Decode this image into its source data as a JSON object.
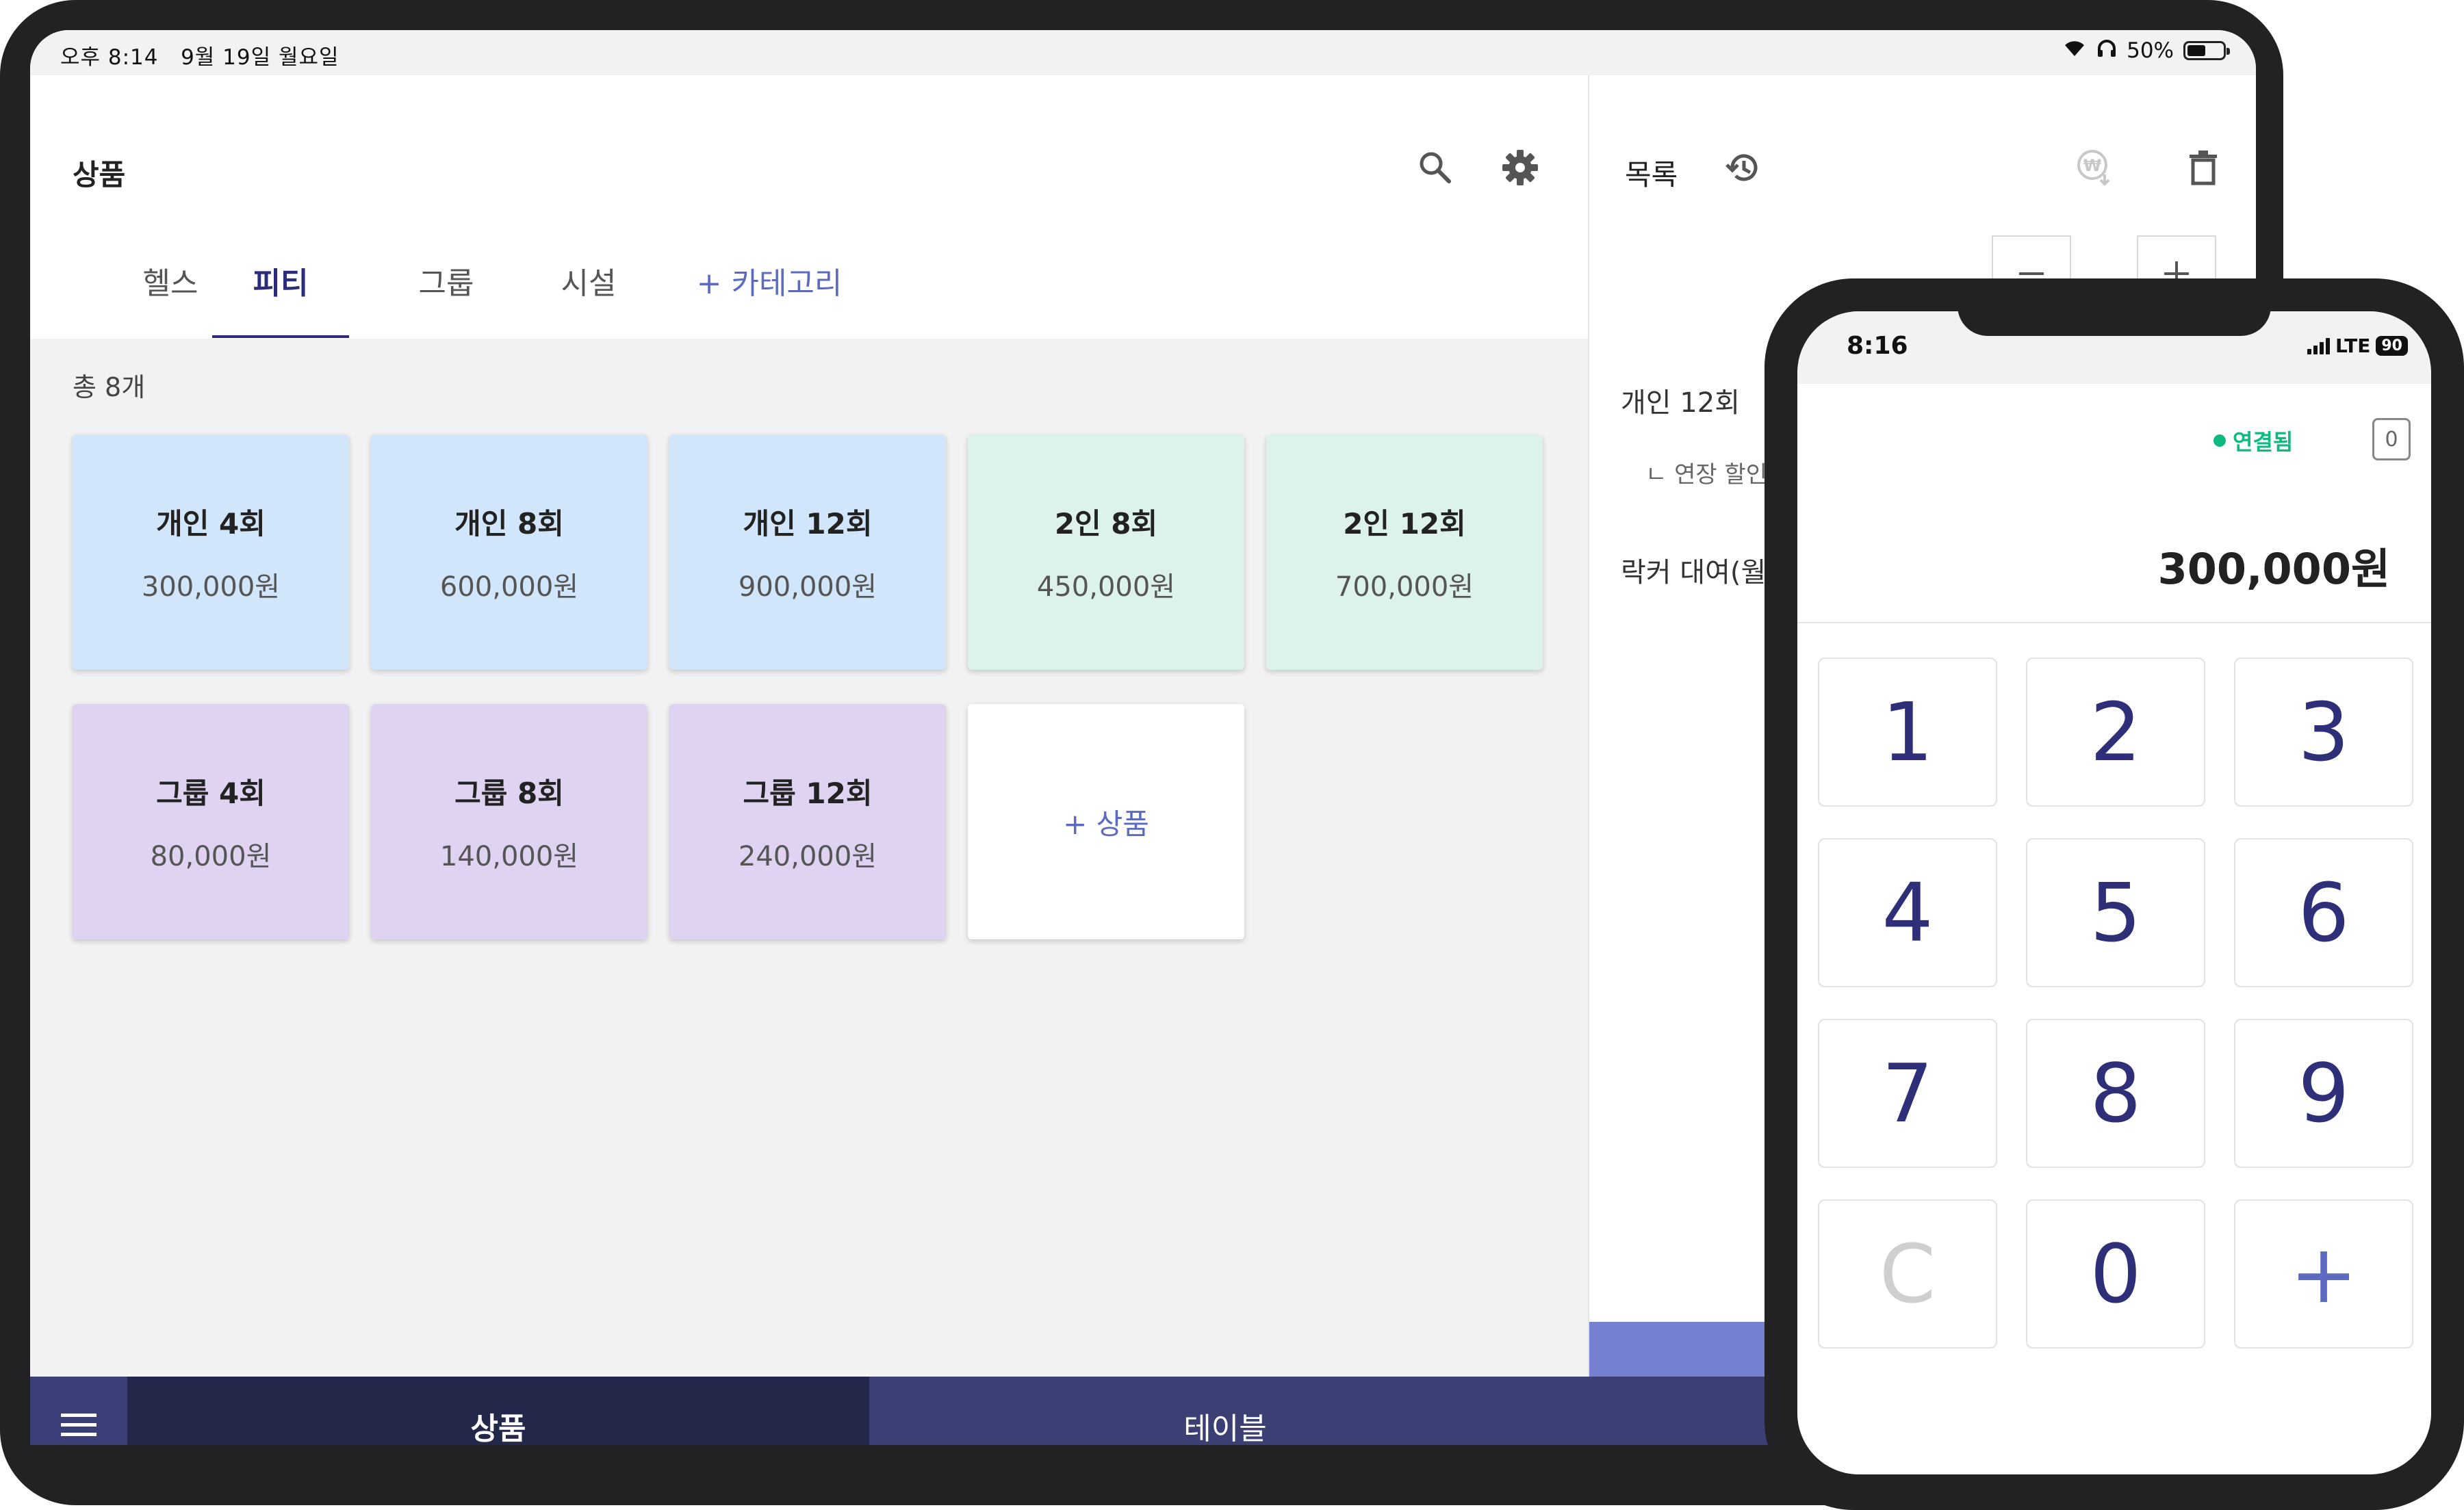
{
  "status_bar": {
    "time": "오후 8:14",
    "date": "9월 19일 월요일",
    "battery": "50%"
  },
  "products_pane": {
    "title": "상품",
    "tabs": [
      {
        "label": "헬스",
        "active": false
      },
      {
        "label": "피티",
        "active": true
      },
      {
        "label": "그룹",
        "active": false
      },
      {
        "label": "시설",
        "active": false
      }
    ],
    "add_category": "+ 카테고리",
    "total": "총 8개",
    "products": [
      {
        "name": "개인 4회",
        "price": "300,000원",
        "color": "#d2e6fb"
      },
      {
        "name": "개인 8회",
        "price": "600,000원",
        "color": "#d2e6fb"
      },
      {
        "name": "개인 12회",
        "price": "900,000원",
        "color": "#d2e6fb"
      },
      {
        "name": "2인 8회",
        "price": "450,000원",
        "color": "#dcf2ea"
      },
      {
        "name": "2인 12회",
        "price": "700,000원",
        "color": "#dcf2ea"
      },
      {
        "name": "그룹 4회",
        "price": "80,000원",
        "color": "#e0d3f1"
      },
      {
        "name": "그룹 8회",
        "price": "140,000원",
        "color": "#e0d3f1"
      },
      {
        "name": "그룹 12회",
        "price": "240,000원",
        "color": "#e0d3f1"
      }
    ],
    "add_product": "+ 상품"
  },
  "order_pane": {
    "title": "목록",
    "items": [
      {
        "label": "개인 12회"
      },
      {
        "label": "ㄴ 연장 할인"
      },
      {
        "label": "락커 대여(월"
      }
    ]
  },
  "bottom_nav": {
    "products": "상품",
    "table": "테이블"
  },
  "phone": {
    "time": "8:16",
    "network": "LTE",
    "battery": "90",
    "connection": "연결됨",
    "count": "0",
    "amount": "300,000원",
    "keys": [
      "1",
      "2",
      "3",
      "4",
      "5",
      "6",
      "7",
      "8",
      "9",
      "C",
      "0",
      "+"
    ]
  },
  "colors": {
    "accent": "#5c6bc0",
    "nav_dark": "#23274a",
    "nav": "#3b3f73",
    "connected": "#10b981"
  }
}
